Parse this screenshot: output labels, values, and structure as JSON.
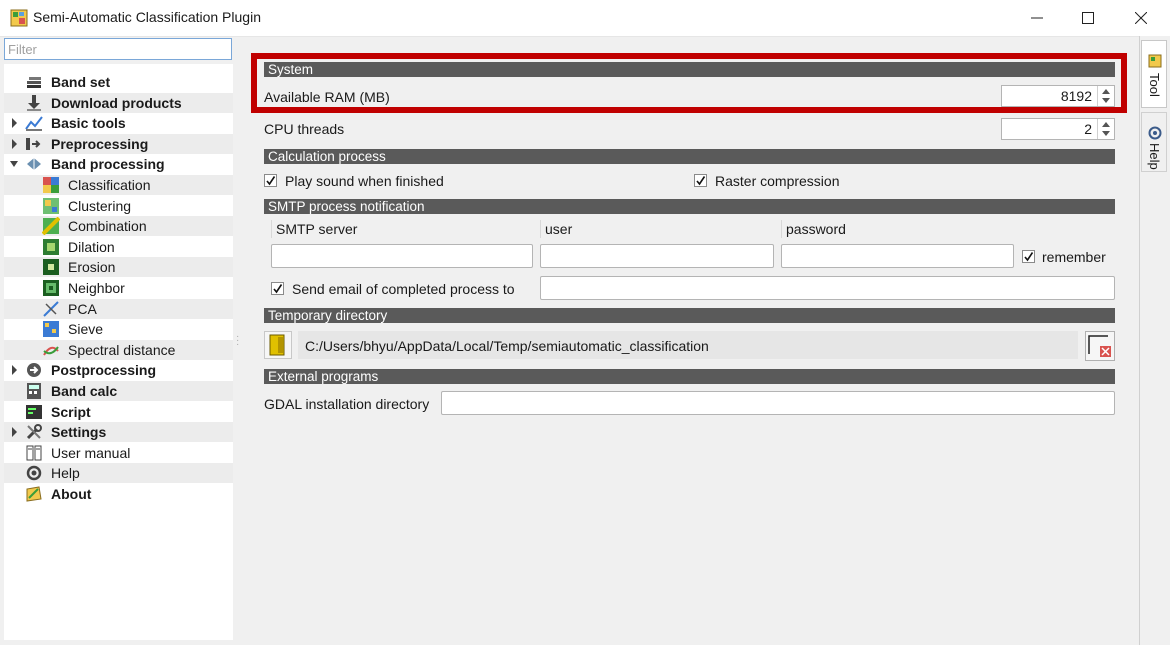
{
  "window": {
    "title": "Semi-Automatic Classification Plugin"
  },
  "filter": {
    "placeholder": "Filter"
  },
  "tree": [
    {
      "label": "Band set",
      "bold": true,
      "icon": "band-set-icon",
      "arrow": false,
      "indent": 0
    },
    {
      "label": "Download products",
      "bold": true,
      "icon": "download-icon",
      "arrow": false,
      "indent": 0
    },
    {
      "label": "Basic tools",
      "bold": true,
      "icon": "basic-tools-icon",
      "arrow": "right",
      "indent": 0
    },
    {
      "label": "Preprocessing",
      "bold": true,
      "icon": "preprocessing-icon",
      "arrow": "right",
      "indent": 0
    },
    {
      "label": "Band processing",
      "bold": true,
      "icon": "band-processing-icon",
      "arrow": "down",
      "indent": 0
    },
    {
      "label": "Classification",
      "bold": false,
      "icon": "classification-icon",
      "arrow": false,
      "indent": 1
    },
    {
      "label": "Clustering",
      "bold": false,
      "icon": "clustering-icon",
      "arrow": false,
      "indent": 1
    },
    {
      "label": "Combination",
      "bold": false,
      "icon": "combination-icon",
      "arrow": false,
      "indent": 1
    },
    {
      "label": "Dilation",
      "bold": false,
      "icon": "dilation-icon",
      "arrow": false,
      "indent": 1
    },
    {
      "label": "Erosion",
      "bold": false,
      "icon": "erosion-icon",
      "arrow": false,
      "indent": 1
    },
    {
      "label": "Neighbor",
      "bold": false,
      "icon": "neighbor-icon",
      "arrow": false,
      "indent": 1
    },
    {
      "label": "PCA",
      "bold": false,
      "icon": "pca-icon",
      "arrow": false,
      "indent": 1
    },
    {
      "label": "Sieve",
      "bold": false,
      "icon": "sieve-icon",
      "arrow": false,
      "indent": 1
    },
    {
      "label": "Spectral distance",
      "bold": false,
      "icon": "spectral-distance-icon",
      "arrow": false,
      "indent": 1
    },
    {
      "label": "Postprocessing",
      "bold": true,
      "icon": "postprocessing-icon",
      "arrow": "right",
      "indent": 0
    },
    {
      "label": "Band calc",
      "bold": true,
      "icon": "band-calc-icon",
      "arrow": false,
      "indent": 0
    },
    {
      "label": "Script",
      "bold": true,
      "icon": "script-icon",
      "arrow": false,
      "indent": 0
    },
    {
      "label": "Settings",
      "bold": true,
      "icon": "settings-icon",
      "arrow": "right",
      "indent": 0
    },
    {
      "label": "User manual",
      "bold": false,
      "icon": "user-manual-icon",
      "arrow": false,
      "indent": 0
    },
    {
      "label": "Help",
      "bold": false,
      "icon": "help-icon",
      "arrow": false,
      "indent": 0
    },
    {
      "label": "About",
      "bold": true,
      "icon": "about-icon",
      "arrow": false,
      "indent": 0
    }
  ],
  "system": {
    "header": "System",
    "ram_label": "Available RAM (MB)",
    "ram_value": "8192",
    "cpu_label": "CPU threads",
    "cpu_value": "2"
  },
  "calculation": {
    "header": "Calculation process",
    "play_sound": "Play sound when finished",
    "raster_compression": "Raster compression"
  },
  "smtp": {
    "header": "SMTP process notification",
    "server_label": "SMTP server",
    "user_label": "user",
    "password_label": "password",
    "remember": "remember",
    "send_email": "Send email of completed process to"
  },
  "temp": {
    "header": "Temporary directory",
    "path": "C:/Users/bhyu/AppData/Local/Temp/semiautomatic_classification"
  },
  "external": {
    "header": "External programs",
    "gdal_label": "GDAL installation directory"
  },
  "tabs": {
    "tool": "Tool",
    "help": "Help"
  },
  "colors": {
    "highlight": "#c00000",
    "section": "#5a5a5a"
  }
}
